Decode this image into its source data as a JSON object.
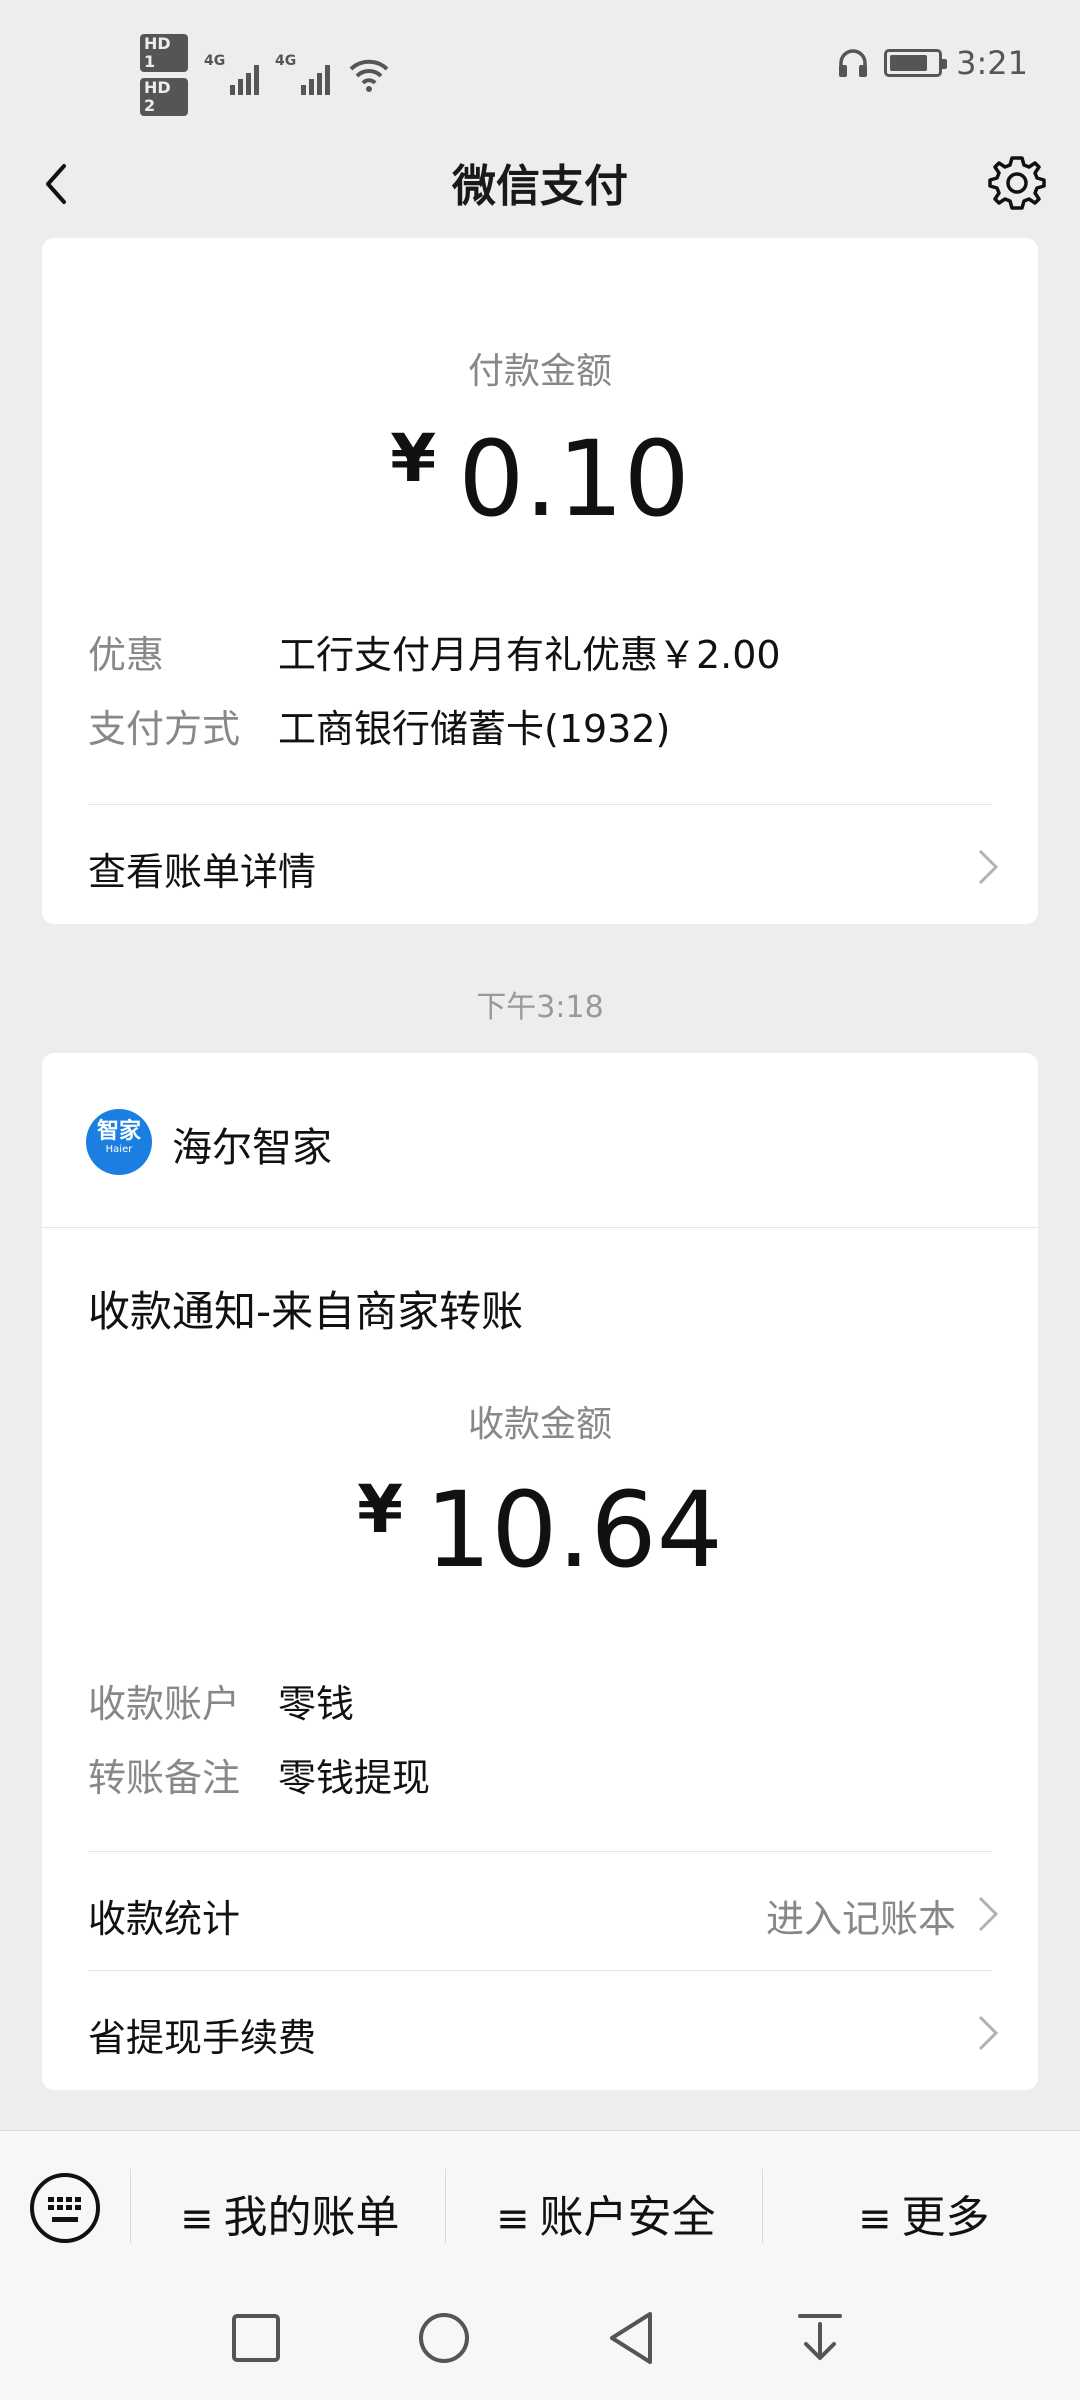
{
  "status_bar": {
    "hd1": "HD 1",
    "hd2": "HD 2",
    "net1": "4G",
    "net2": "4G",
    "time": "3:21"
  },
  "navbar": {
    "title": "微信支付"
  },
  "payment_card": {
    "amount_label": "付款金额",
    "currency": "¥",
    "amount": "0.10",
    "rows": [
      {
        "key": "优惠",
        "value": "工行支付月月有礼优惠￥2.00"
      },
      {
        "key": "支付方式",
        "value": "工商银行储蓄卡(1932)"
      }
    ],
    "bill_link": "查看账单详情"
  },
  "timestamp": "下午3:18",
  "receipt_card": {
    "merchant_logo_text": "智家",
    "merchant_logo_sub": "Haier",
    "merchant_name": "海尔智家",
    "title": "收款通知-来自商家转账",
    "amount_label": "收款金额",
    "currency": "¥",
    "amount": "10.64",
    "rows": [
      {
        "key": "收款账户",
        "value": "零钱"
      },
      {
        "key": "转账备注",
        "value": "零钱提现"
      }
    ],
    "stats_label": "收款统计",
    "stats_hint": "进入记账本",
    "fee_label": "省提现手续费"
  },
  "bottom_menu": {
    "items": [
      {
        "label": "我的账单"
      },
      {
        "label": "账户安全"
      },
      {
        "label": "更多"
      }
    ]
  },
  "colors": {
    "background": "#ededed",
    "card": "#ffffff",
    "secondary_text": "#888888",
    "logo_blue": "#1a7fe0"
  }
}
